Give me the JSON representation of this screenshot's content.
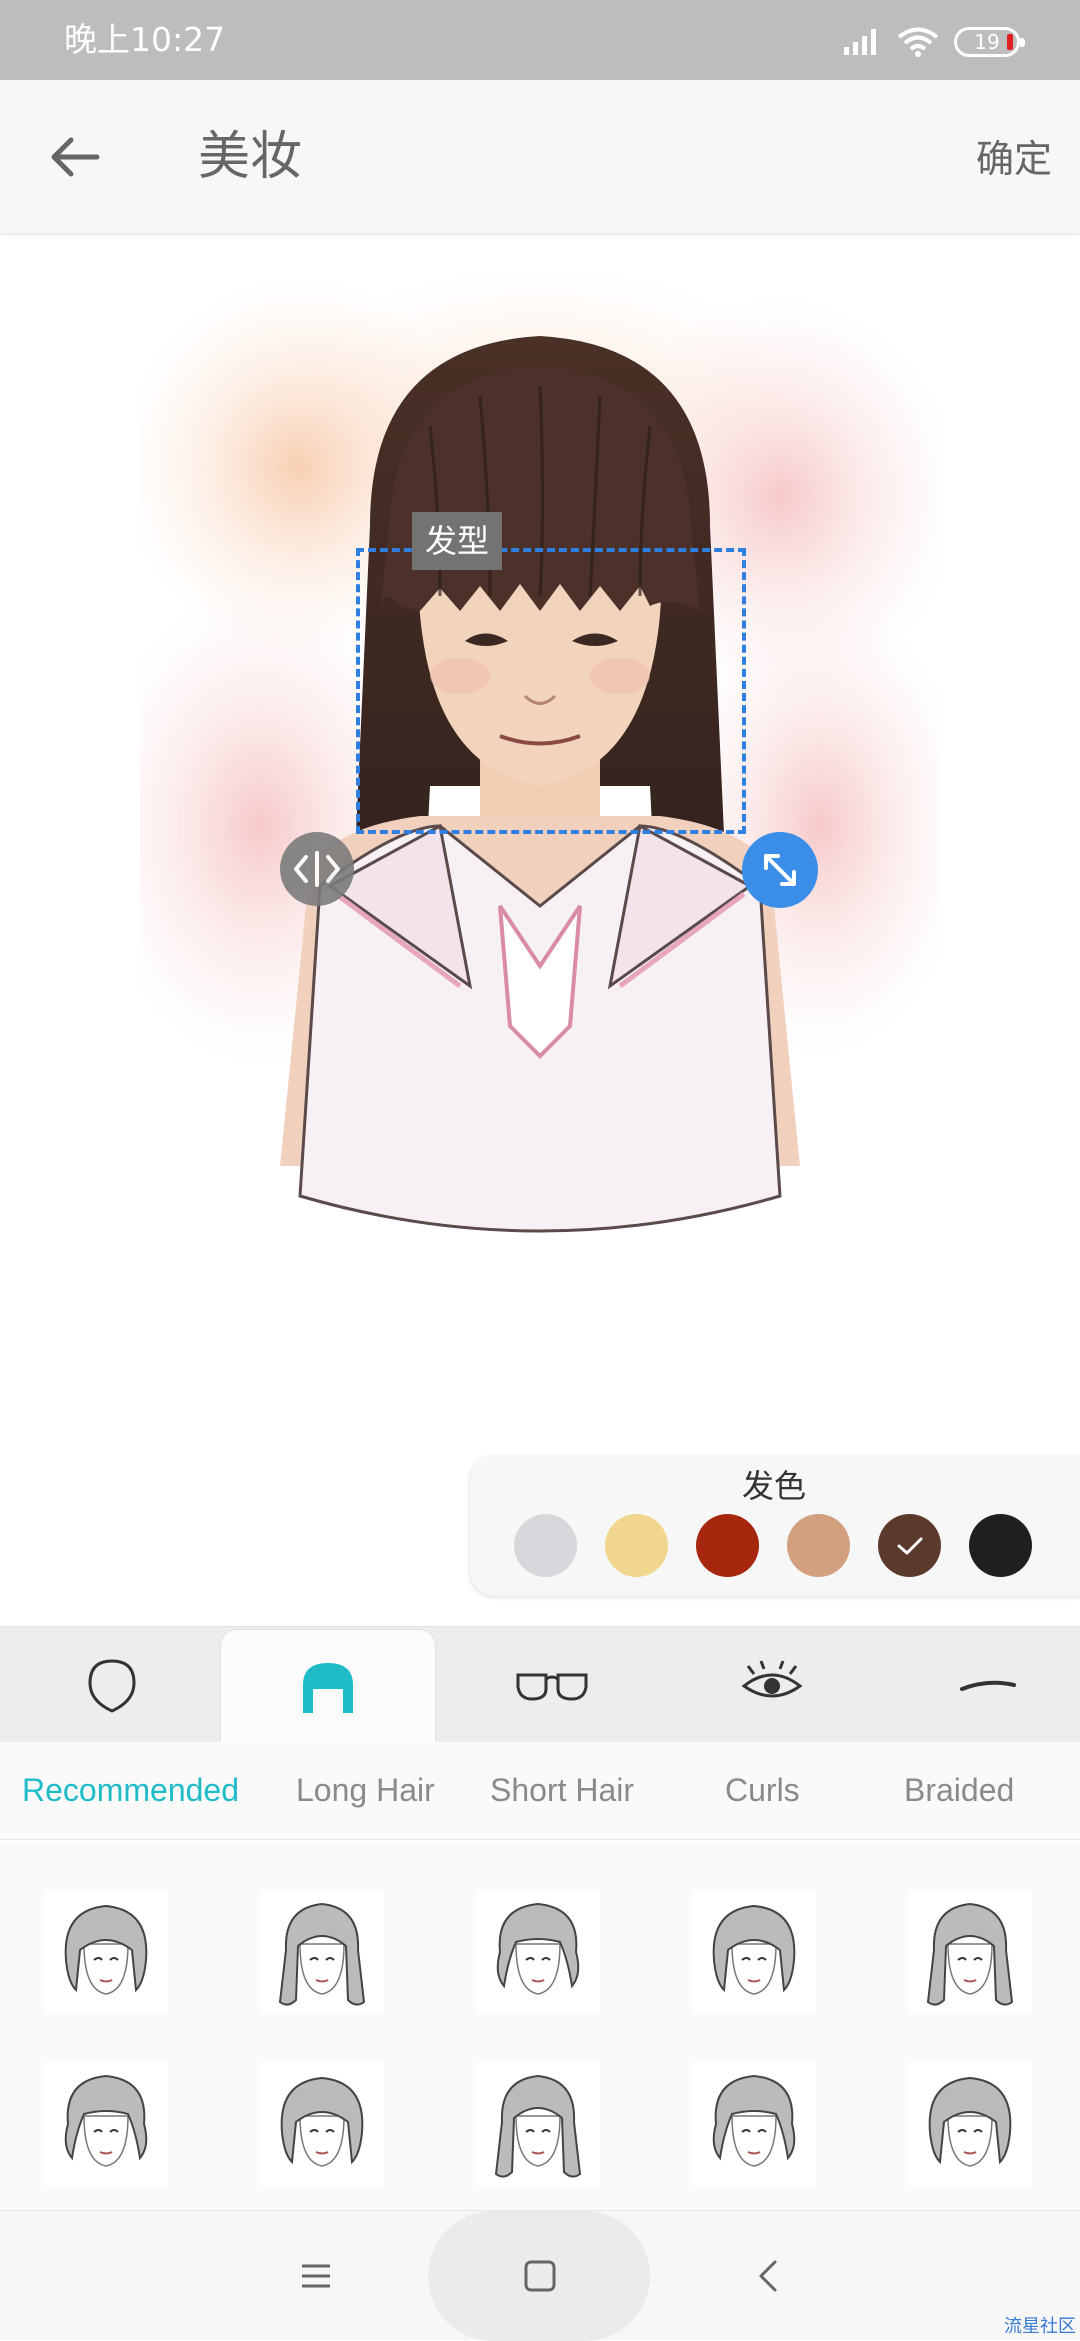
{
  "status_bar": {
    "time": "晚上10:27",
    "battery_level": "19",
    "icons": [
      "signal-icon",
      "wifi-icon",
      "battery-icon"
    ]
  },
  "header": {
    "back_icon": "arrow-left-icon",
    "title": "美妆",
    "confirm_label": "确定"
  },
  "editor": {
    "selection_label": "发型",
    "handles": [
      "mirror-icon",
      "resize-icon"
    ]
  },
  "hair_color": {
    "title": "发色",
    "selected_index": 4,
    "colors": [
      "#d6d8dc",
      "#f0d68e",
      "#a6260e",
      "#d2a07e",
      "#5b3a2c",
      "#1f1f1f"
    ]
  },
  "categories": {
    "active_index": 1,
    "items": [
      "face-shape-icon",
      "hair-icon",
      "glasses-icon",
      "eye-icon",
      "eyebrow-icon"
    ]
  },
  "style_tabs": {
    "active_index": 0,
    "items": [
      "Recommended",
      "Long Hair",
      "Short Hair",
      "Curls",
      "Braided"
    ]
  },
  "hairstyles": {
    "rows": 2,
    "columns": 5
  },
  "nav_bar": {
    "icons": [
      "menu-icon",
      "home-icon",
      "back-icon"
    ]
  },
  "watermark": "流星社区",
  "colors": {
    "accent": "#1fbcc8",
    "selection": "#2f7fe0",
    "status_bar": "#bdbdbd"
  }
}
